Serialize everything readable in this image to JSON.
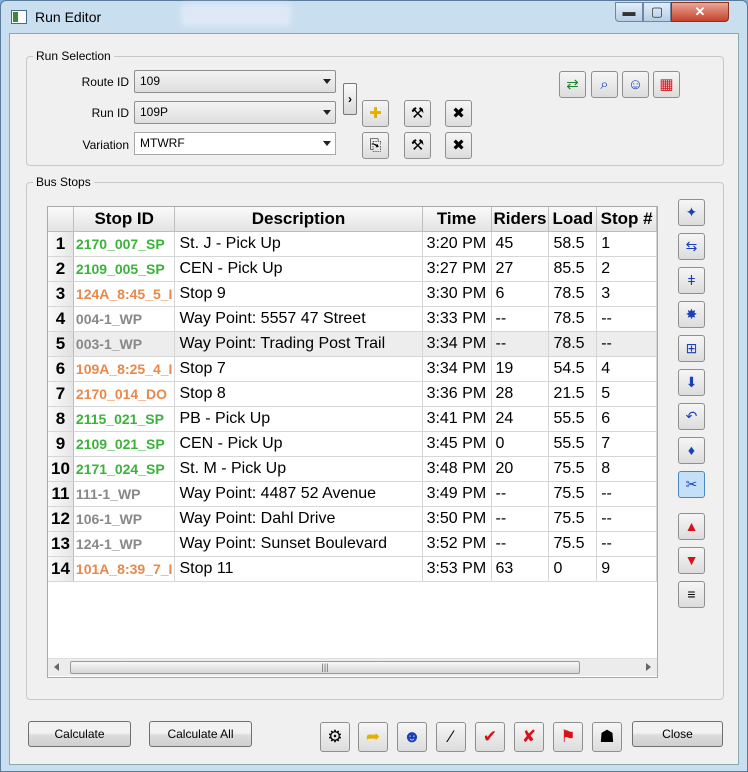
{
  "window": {
    "title": "Run Editor",
    "min_glyph": "▬",
    "max_glyph": "▢",
    "close_glyph": "✕"
  },
  "run_selection": {
    "legend": "Run Selection",
    "route_label": "Route ID",
    "route_value": "109",
    "run_label": "Run ID",
    "run_value": "109P",
    "variation_label": "Variation",
    "variation_value": "MTWRF",
    "expander_glyph": "›"
  },
  "bus_stops": {
    "legend": "Bus Stops",
    "columns": [
      "Stop ID",
      "Description",
      "Time",
      "Riders",
      "Load",
      "Stop #"
    ],
    "rows": [
      [
        "1",
        "2170_007_SP",
        "St. J - Pick Up",
        "3:20 PM",
        "45",
        "58.5",
        "1"
      ],
      [
        "2",
        "2109_005_SP",
        "CEN - Pick Up",
        "3:27 PM",
        "27",
        "85.5",
        "2"
      ],
      [
        "3",
        "124A_8:45_5_I",
        "Stop 9",
        "3:30 PM",
        "6",
        "78.5",
        "3"
      ],
      [
        "4",
        "004-1_WP",
        "Way Point: 5557 47 Street",
        "3:33 PM",
        "--",
        "78.5",
        "--"
      ],
      [
        "5",
        "003-1_WP",
        "Way Point: Trading Post Trail",
        "3:34 PM",
        "--",
        "78.5",
        "--"
      ],
      [
        "6",
        "109A_8:25_4_I",
        "Stop 7",
        "3:34 PM",
        "19",
        "54.5",
        "4"
      ],
      [
        "7",
        "2170_014_DO",
        "Stop 8",
        "3:36 PM",
        "28",
        "21.5",
        "5"
      ],
      [
        "8",
        "2115_021_SP",
        "PB - Pick Up",
        "3:41 PM",
        "24",
        "55.5",
        "6"
      ],
      [
        "9",
        "2109_021_SP",
        "CEN - Pick Up",
        "3:45 PM",
        "0",
        "55.5",
        "7"
      ],
      [
        "10",
        "2171_024_SP",
        "St. M - Pick Up",
        "3:48 PM",
        "20",
        "75.5",
        "8"
      ],
      [
        "11",
        "111-1_WP",
        "Way Point: 4487 52 Avenue",
        "3:49 PM",
        "--",
        "75.5",
        "--"
      ],
      [
        "12",
        "106-1_WP",
        "Way Point: Dahl Drive",
        "3:50 PM",
        "--",
        "75.5",
        "--"
      ],
      [
        "13",
        "124-1_WP",
        "Way Point: Sunset Boulevard",
        "3:52 PM",
        "--",
        "75.5",
        "--"
      ],
      [
        "14",
        "101A_8:39_7_I",
        "Stop 11",
        "3:53 PM",
        "63",
        "0",
        "9"
      ]
    ],
    "stop_id_colors": [
      "green",
      "green",
      "orange",
      "gray",
      "gray",
      "orange",
      "orange",
      "green",
      "green",
      "green",
      "gray",
      "gray",
      "gray",
      "orange"
    ],
    "scroll_thumb_glyph": "|||"
  },
  "colors": {
    "green_id": "#3bb33b",
    "orange_id": "#e8884a",
    "waypoint_id": "#888888",
    "accent_blue": "#1a3fb8",
    "move_red": "#d8121a"
  },
  "icons": {
    "top_right": [
      "swap-map-icon",
      "zoom-search-icon",
      "route-people-icon",
      "grid-map-icon"
    ],
    "run_tools": [
      "add-run-icon",
      "edit-run-icon",
      "delete-run-icon",
      "copy-variation-icon",
      "edit-variation-icon",
      "delete-variation-icon"
    ],
    "side": [
      "insert-stop-icon",
      "swap-stop-icon",
      "insert-waypoint-icon",
      "auto-stop-icon",
      "add-stop-icon",
      "stop-down-icon",
      "reverse-icon",
      "waypoint-icon",
      "remove-stop-icon",
      "move-up-icon",
      "move-down-icon",
      "sort-icon"
    ],
    "bottom": [
      "optimize-icon",
      "direction-icon",
      "students-icon",
      "wand-icon",
      "bus-route-icon",
      "bus-check-icon",
      "bus-assign-icon",
      "bus-driver-icon"
    ]
  },
  "glyphs": {
    "top_right": [
      "⇄",
      "⌕",
      "☺",
      "▦"
    ],
    "run_tools": [
      "✚",
      "⚒",
      "✖",
      "⎘",
      "⚒",
      "✖"
    ],
    "side": [
      "✦",
      "⇆",
      "ǂ",
      "✸",
      "⊞",
      "⬇",
      "↶",
      "♦",
      "✂",
      "▲",
      "▼",
      "≡"
    ],
    "bottom": [
      "⚙",
      "➦",
      "☻",
      "⁄",
      "✔",
      "✘",
      "⚑",
      "☗"
    ]
  },
  "buttons": {
    "calculate": "Calculate",
    "calculate_all": "Calculate All",
    "close": "Close"
  }
}
